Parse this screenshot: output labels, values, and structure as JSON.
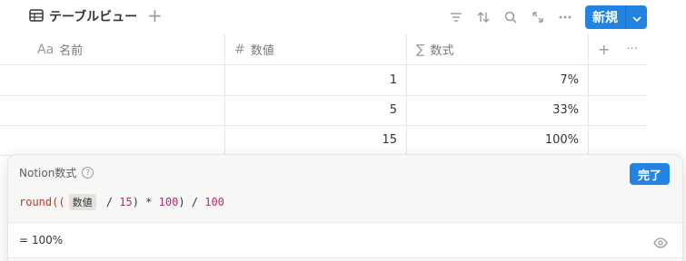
{
  "toolbar": {
    "view_label": "テーブルビュー",
    "view_icon": "table-icon",
    "add_view_label": "+",
    "icons": [
      "filter-icon",
      "sort-icon",
      "search-icon",
      "expand-icon",
      "more-icon"
    ],
    "new_label": "新規",
    "accent": "#2383e2"
  },
  "table": {
    "columns": [
      {
        "icon_text": "Aa",
        "label": "名前"
      },
      {
        "icon_text": "#",
        "label": "数値"
      },
      {
        "icon_text": "∑",
        "label": "数式"
      }
    ],
    "extra_header": {
      "add": "+",
      "more": "···"
    },
    "rows": [
      {
        "name": "",
        "number": "1",
        "formula": "7%"
      },
      {
        "name": "",
        "number": "5",
        "formula": "33%"
      },
      {
        "name": "",
        "number": "15",
        "formula": "100%"
      }
    ]
  },
  "formula_popup": {
    "title": "Notion数式",
    "help_icon": "help-icon",
    "done_label": "完了",
    "code": {
      "t1": "round",
      "t2": "((",
      "prop": "数値",
      "t3": " / ",
      "t4": "15",
      "t5": ") * ",
      "t6": "100",
      "t7": ") / ",
      "t8": "100"
    },
    "result": "= 100%",
    "eye_icon": "eye-icon"
  }
}
